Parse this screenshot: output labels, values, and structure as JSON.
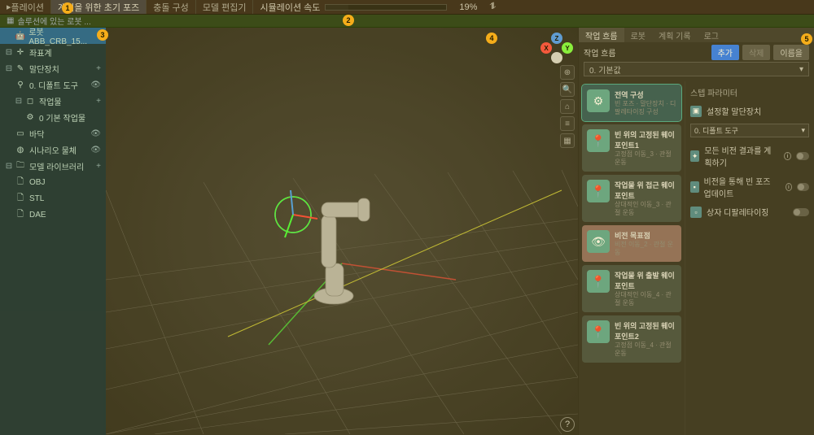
{
  "topbar": {
    "play_label": "플레이션",
    "tabs": [
      "계획을 위한 초기 포즈",
      "충돌 구성",
      "모델 편집기"
    ],
    "sim_label": "시뮬레이션 속도",
    "sim_pct": "19%"
  },
  "secondbar": {
    "text": "솔루션에 있는 로봇 ..."
  },
  "tree": {
    "robot": "로봇 ABB_CRB_15...",
    "coord": "좌표계",
    "endeff": "말단장치",
    "endeff_tool": "0. 디폴트 도구",
    "workpieces": "작업물",
    "workpiece_base": "0 기본 작업물",
    "floor": "바닥",
    "scenario": "시나리오 물체",
    "models": "모델 라이브러리",
    "model_obj": "OBJ",
    "model_stl": "STL",
    "model_dae": "DAE"
  },
  "right": {
    "tabs": [
      "작업 흐름",
      "로봇",
      "계획 기록",
      "로그"
    ],
    "panel_title": "작업 흐름",
    "btn_add": "추가",
    "btn_del": "삭제",
    "btn_rename": "이름을",
    "dropdown": "0. 기본값",
    "params_title": "스텝 파라미터",
    "param_endeff_label": "설정할 말단장치",
    "param_endeff_value": "0. 디폴트 도구",
    "param_vision": "모든 비전 결과를 계획하기",
    "param_bin": "비전을 통해 빈 포즈 업데이트",
    "param_residual": "상자 디팔레타이징"
  },
  "steps": [
    {
      "title": "전역 구성",
      "subtitle": "빈 포즈 · 말단장치 · 디팔레타이징 구성",
      "icon": "⚙",
      "selected": true
    },
    {
      "title": "빈 위의 고정된 웨이포인트1",
      "subtitle": "고정점 이동_3 · 관절 운동",
      "icon": "📍"
    },
    {
      "title": "작업물 위 접근 웨이포인트",
      "subtitle": "상대적인 이동_3 · 관절 운동",
      "icon": "📍"
    },
    {
      "title": "비전 목표점",
      "subtitle": "비전 이동_2 · 관절 운동",
      "icon": "👁",
      "vision": true
    },
    {
      "title": "작업물 위 출발 웨이포인트",
      "subtitle": "상대적인 이동_4 · 관절 운동",
      "icon": "📍"
    },
    {
      "title": "빈 위의 고정된 웨이포인트2",
      "subtitle": "고정점 이동_4 · 관절 운동",
      "icon": "📍"
    }
  ],
  "markers": [
    "1",
    "2",
    "3",
    "4",
    "5"
  ]
}
